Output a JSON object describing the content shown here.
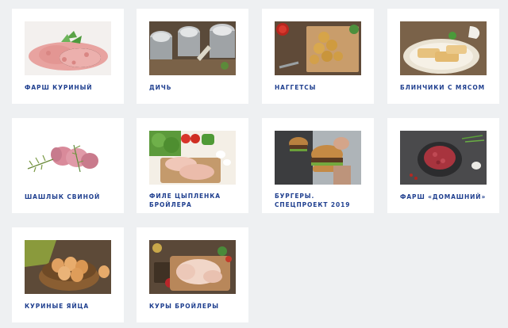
{
  "products": [
    {
      "label": "ФАРШ КУРИНЫЙ",
      "image": "minced-chicken"
    },
    {
      "label": "ДИЧЬ",
      "image": "canned-game"
    },
    {
      "label": "НАГГЕТСЫ",
      "image": "nuggets"
    },
    {
      "label": "БЛИНЧИКИ С МЯСОМ",
      "image": "pancakes-with-meat"
    },
    {
      "label": "ШАШЛЫК СВИНОЙ",
      "image": "pork-skewer"
    },
    {
      "label": "ФИЛЕ ЦЫПЛЕНКА БРОЙЛЕРА",
      "image": "chicken-fillet"
    },
    {
      "label": "БУРГЕРЫ. СПЕЦПРОЕКТ 2019",
      "image": "burger"
    },
    {
      "label": "ФАРШ «ДОМАШНИЙ»",
      "image": "minced-meat-homemade"
    },
    {
      "label": "КУРИНЫЕ ЯЙЦА",
      "image": "chicken-eggs"
    },
    {
      "label": "КУРЫ БРОЙЛЕРЫ",
      "image": "whole-broiler-chicken"
    }
  ]
}
